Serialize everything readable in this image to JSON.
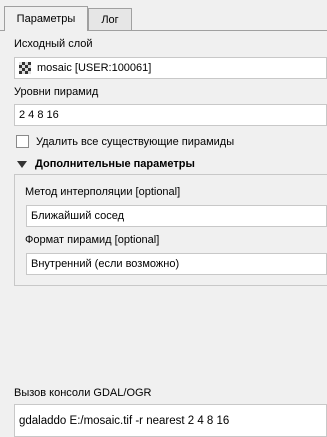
{
  "tabs": [
    {
      "label": "Параметры",
      "active": true
    },
    {
      "label": "Лог",
      "active": false
    }
  ],
  "input_layer": {
    "label": "Исходный слой",
    "value": "mosaic [USER:100061]",
    "icon": "raster-layer-icon"
  },
  "pyramid_levels": {
    "label": "Уровни пирамид",
    "value": "2 4 8 16"
  },
  "clean_option": {
    "label": "Удалить все существующие пирамиды",
    "checked": false
  },
  "advanced": {
    "title": "Дополнительные параметры",
    "expanded": true,
    "resampling": {
      "label": "Метод интерполяции [optional]",
      "value": "Ближайший сосед"
    },
    "format": {
      "label": "Формат пирамид [optional]",
      "value": "Внутренний (если возможно)"
    }
  },
  "console": {
    "label": "Вызов консоли GDAL/OGR",
    "command": "gdaladdo E:/mosaic.tif -r nearest 2 4 8 16"
  }
}
